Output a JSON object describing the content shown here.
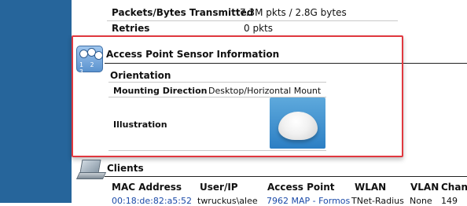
{
  "traffic": {
    "packets_label": "Packets/Bytes Transmitted",
    "packets_value": "7.3M pkts / 2.8G bytes",
    "retries_label": "Retries",
    "retries_value": "0 pkts"
  },
  "sensor_section": {
    "title": "Access Point Sensor Information",
    "icon": "sensor-icon",
    "icon_numbers": "1 2 3",
    "orientation_header": "Orientation",
    "mounting_label": "Mounting Direction",
    "mounting_value": "Desktop/Horizontal Mount",
    "illustration_label": "Illustration",
    "illustration_image": "access-point-desktop-illustration"
  },
  "clients_section": {
    "title": "Clients",
    "icon": "laptop-icon",
    "columns": [
      "MAC Address",
      "User/IP",
      "Access Point",
      "WLAN",
      "VLAN",
      "Chann"
    ],
    "rows": [
      {
        "mac": "00:18:de:82:a5:52",
        "user_ip": "twruckus\\alee",
        "access_point": "7962 MAP - Formos",
        "wlan": "TNet-Radius",
        "vlan": "None",
        "channel": "149"
      }
    ]
  },
  "colors": {
    "sidebar": "#26659b",
    "highlight_border": "#e0383f",
    "link": "#1b4aa8"
  }
}
